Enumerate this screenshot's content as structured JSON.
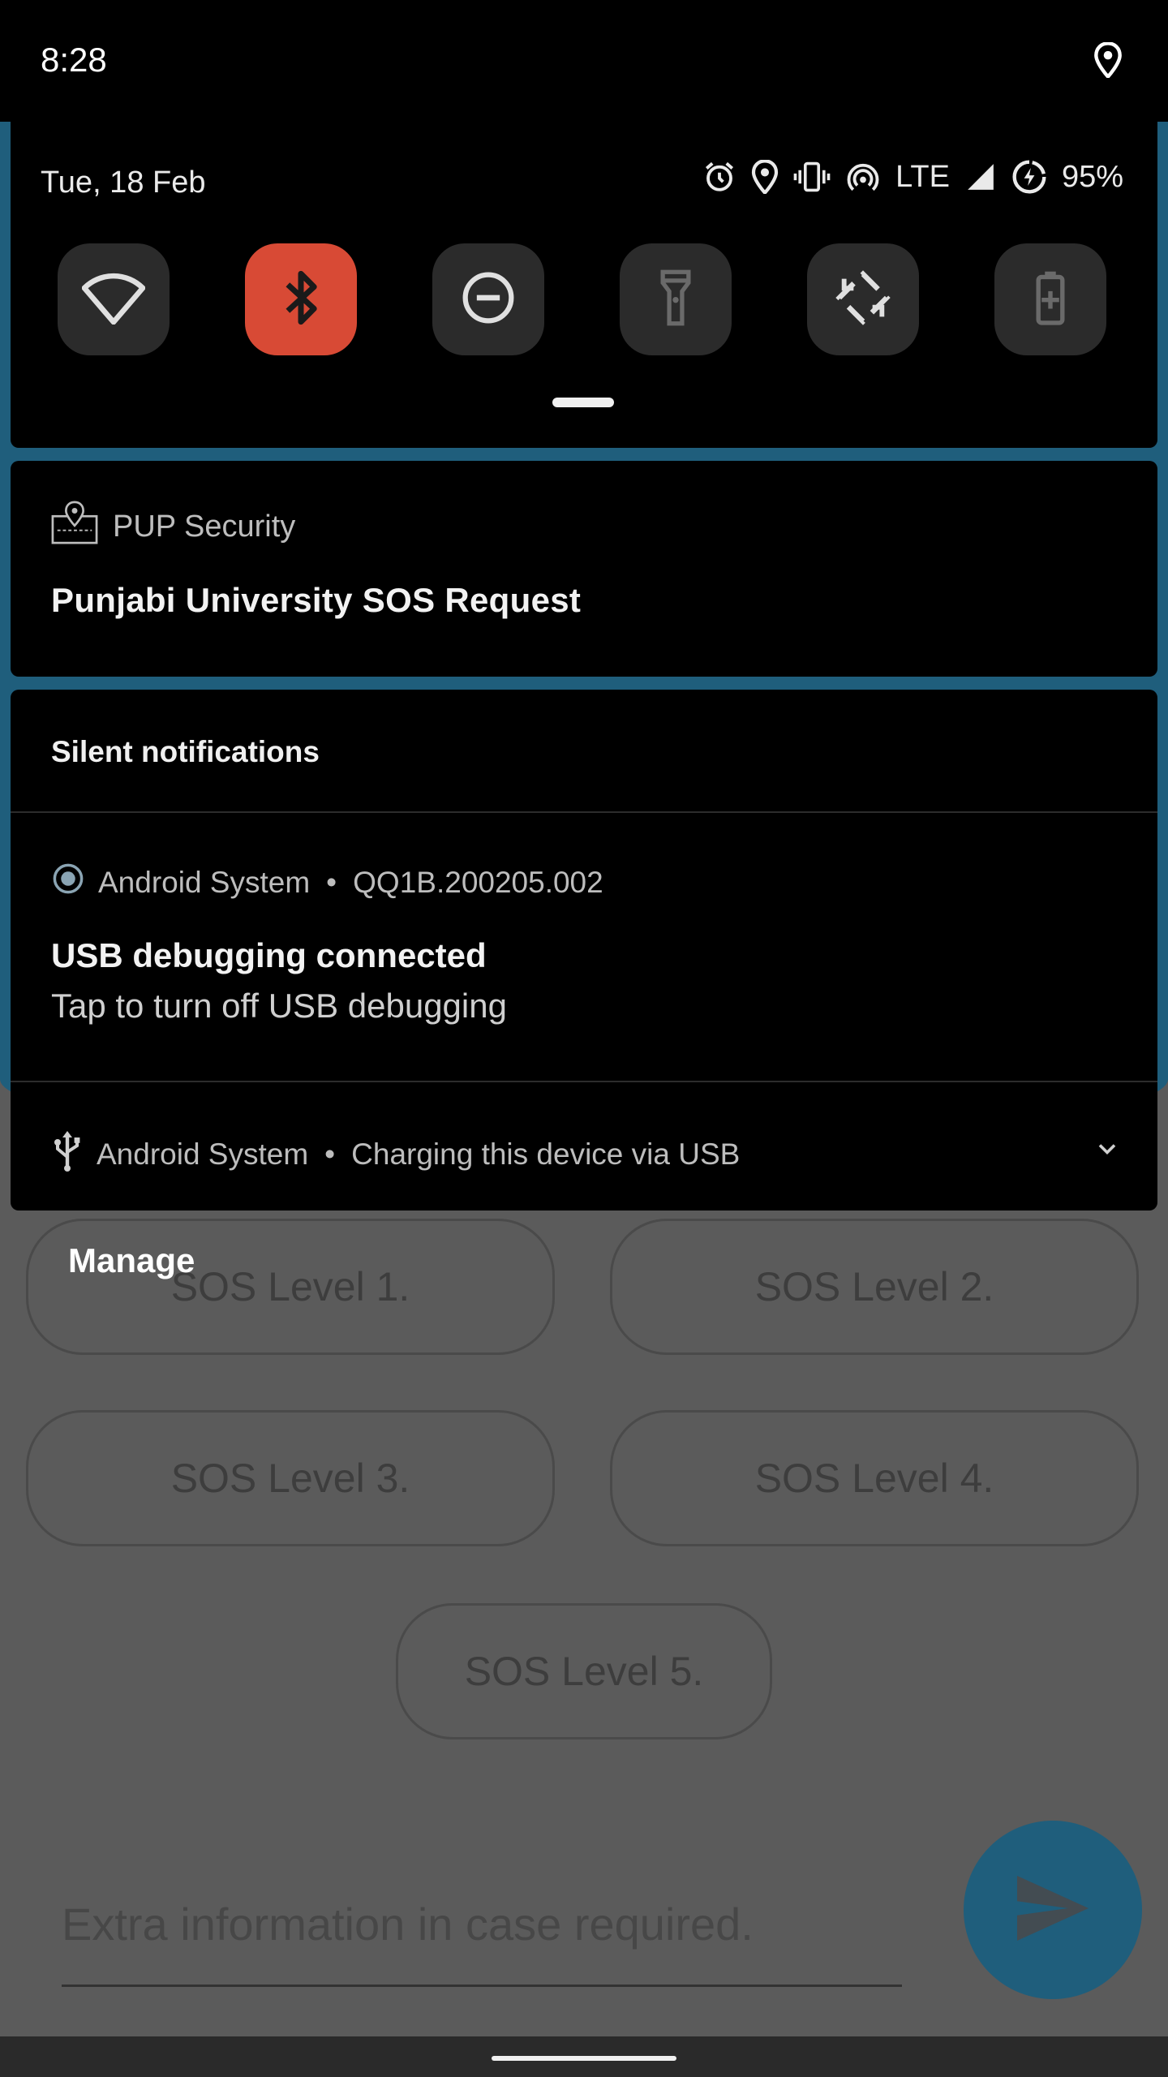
{
  "status_bar": {
    "time": "8:28",
    "icons": [
      "location-icon"
    ]
  },
  "quick_settings": {
    "date": "Tue, 18 Feb",
    "network_type": "LTE",
    "battery_percent": "95%",
    "status_icons": [
      "alarm-icon",
      "location-icon",
      "vibrate-icon",
      "hotspot-icon",
      "signal-icon",
      "battery-saver-icon"
    ],
    "tiles": [
      {
        "name": "wifi",
        "icon": "wifi-icon",
        "active": false
      },
      {
        "name": "bluetooth",
        "icon": "bluetooth-icon",
        "active": true
      },
      {
        "name": "do-not-disturb",
        "icon": "do-not-disturb-icon",
        "active": false
      },
      {
        "name": "flashlight",
        "icon": "flashlight-icon",
        "active": false
      },
      {
        "name": "auto-rotate",
        "icon": "auto-rotate-icon",
        "active": false
      },
      {
        "name": "battery-saver",
        "icon": "battery-saver-icon",
        "active": false
      }
    ],
    "colors": {
      "active_tile": "#d84a35",
      "inactive_tile": "#2b2b2b"
    }
  },
  "notifications": {
    "pup": {
      "app_name": "PUP Security",
      "title": "Punjabi University SOS Request"
    },
    "silent_header": "Silent notifications",
    "usb_debugging": {
      "app_name": "Android System",
      "separator": "•",
      "build": "QQ1B.200205.002",
      "title": "USB debugging connected",
      "text": "Tap to turn off USB debugging"
    },
    "charging": {
      "app_name": "Android System",
      "separator": "•",
      "text": "Charging this device via USB"
    },
    "manage_label": "Manage"
  },
  "app": {
    "sos_buttons": [
      "SOS Level 1.",
      "SOS Level 2.",
      "SOS Level 3.",
      "SOS Level 4.",
      "SOS Level 5."
    ],
    "extra_info_placeholder": "Extra information in case required.",
    "colors": {
      "primary": "#1f5e7c"
    }
  }
}
